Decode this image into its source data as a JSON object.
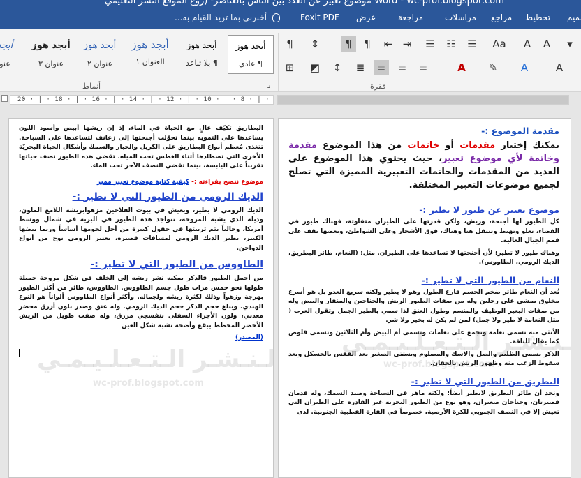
{
  "window": {
    "title": "Word - wc-prof.blogspot.com موضوع تعبير عن العدد بين الناس بالعناصر- (زوع الموقع النشر التعليمي"
  },
  "tabs": [
    {
      "label": "تصميم"
    },
    {
      "label": "تخطيط"
    },
    {
      "label": "مراجع"
    },
    {
      "label": "مراسلات"
    },
    {
      "label": "مراجعة"
    },
    {
      "label": "عرض"
    },
    {
      "label": "Foxit PDF"
    }
  ],
  "tell_me": {
    "text": "أخبرني بما تريد القيام به..."
  },
  "ribbon": {
    "group_styles_label": "أنماط",
    "group_paragraph_label": "فقرة",
    "styles": [
      {
        "preview": "أبجد هوز",
        "name": "¶ عادي"
      },
      {
        "preview": "أبجد هوز",
        "name": "¶ بلا تباعد"
      },
      {
        "preview": "أبجد هوز",
        "name": "العنوان ١"
      },
      {
        "preview": "أبجد هوز",
        "name": "عنوان ٢"
      },
      {
        "preview": "أبجد هوز",
        "name": "عنوان ٣"
      },
      {
        "preview": "أبجد هوز",
        "name": "عنوان"
      },
      {
        "preview": "أبجد",
        "name": "عنو"
      }
    ],
    "icons": {
      "pilcrow": "¶",
      "rtl": "¶",
      "sort": "↕",
      "borders": "⊞",
      "shading": "◩"
    }
  },
  "ruler": {
    "numbers": "20 · | · 18 · | · 16 · | · 14 · | · 12 · | · 10 · | · 8 · | · 6 · | · 4 · | · 2 · | ·"
  },
  "right_page": {
    "intro_heading": "مقدمة الموضوع :-",
    "intro_text_1": "يمكنك إختيار ",
    "intro_red_1": "مقدمات",
    "intro_text_2": " أو ",
    "intro_red_2": "خاتمات",
    "intro_text_3": " من هذا الموضوع ",
    "intro_blue_1": "مقدمة وخاتمة لأي موضوع تعبير",
    "intro_text_4": "، حيث يحتوي هذا الموضوع على العديد من المقدمات والخاتمات التعبيرية المميزة التي تصلح لجميع موضوعات التعبير المختلفة.",
    "section1_heading": "موضوع تعبير عن طيور لا تطير :-",
    "section1_p1": "كل الطيور لها أجنحة، وريش، ولكن قدرتها على الطيران متفاوتة، فهناك طيور في الفضاء، تعلو وتهبط وتتنقل هنا وهناك، فوق الأشجار وعلى الشواطئ، وبعضها يقف على قمم الجبال العالية.",
    "section1_p2": "وهناك طيور لا تطير؛ لأن أجنحتها لا تساعدها على الطيران. مثل: (النعام، طائر البطريق، الديك الرومي، الطاووس).",
    "section2_heading": "النعام من الطيور التي لا تطير :-",
    "section2_p1": "تُعد أن النعام طائر ضخم الجسم فارع الطول وهو لا يطير ولكنه سريع العدو بل هو أسرع مخلوق يمشي على رجلين وله من صفات الطيور الريش والجناحين والمنقار والبيض وله من صفات البعير الوظيف والمنسم وطول العنق لذا سمي بالطير الجمل وتقول العرب ( مثل النعامة لا طير ولا جمل) لمن لم يكن له بخير ولا شر.",
    "section2_p2": "الأنثى منه تسمى نعامة وتجمع على نعامات وتسمى أم البيض وأم الثلاثين وتسمى قلوص كما يقال للناقة.",
    "section2_p3": "الذكر يسمى الظليم والصل والاسك والمصلوم ويسمى الصغير بعد الفقس بالحسكل ويعد سقوط الزغب منه وظهور الريش بالحفان.",
    "section3_heading": "البطريق من الطيور التي لا تطير :-",
    "section3_p1": "ونجد أن طائر البطريق لايطير أيضاً؛ ولكنه ماهر في السباحة وصيد السمك، وله قدمان قصيرتان، وجناحان صغيران، وهو نوع من الطيور البحرية غير القادرة على الطيران التي تعيش إلا في النصف الجنوبي للكرة الأرضية، خصوصاً في القارة القطبية الجنوبية. لدى"
  },
  "left_page": {
    "p_top": "البطاريق تكيّف عالٍ مع الحياة في الماء، إذ إن ريشها أبيض وأسود اللون يساعدها على التمويه بينما تحوّلت أجنحتها إلى زعانف لتساعدها على السباحة. تتغذى مُعظم أنواع البطاريق على الكريل والحبار والسمك وأشكال الحياة البحريّة الأخرى التي تصطادها أثناء الغطس تحت المياه. تقضي هذه الطيور نصف حياتها تقريباً على اليابسة، بينما تقضي النصف الآخر تحت الماء.",
    "note_red": "موضوع ننصح بقراءته :-",
    "note_link": "كيفية كتابة موضوع تعبير مميز",
    "section4_heading": "الديك الرومي من الطيور التي لا تطير :-",
    "section4_p1": "الديك الرومي لا يطير، ويعيش في بيوت الفلاحين مزهوابريشة اللامع الملون، وذيله الذي يشبه المروحة، تتواجد هذه الطيور في البرية في شمال ووسط أمريكا، وحالياً يتم تربيتها في حقول كبيرة من أجل لحومها أساساً وربما بيضها الكبير، يطير الديك الرومي لمسافات قصيرة، يعتبر الرومي نوع من أنواع الدواجن.",
    "section5_heading": "الطاووس من الطيور التي لا تطير :-",
    "section5_p1": "من أجمل الطيور فالذكر يمكنه نشر ريشه إلى الخلف في شكل مروحة جميلة طولها نحو خمس مرات طول جسم الطاووس. الطاووس، طائر من أكثر الطيور بهرجة وزهواً وذلك لكثرة ريشه ولجماله. وأكثر أنواع الطاووس ألواناً هو النوع الهندي. ويبلغ حجم الذكر حجم الديك الرومي. وله عنق وصدر بلون أزرق مخضر معدني، ولون الأجزاء السفلى بنفسجي مزرق، وله صفت طويل من الريش الأخضر المخطط يبقع وأضحة تشبه شكل العين",
    "source_label": "(المصدر)"
  },
  "watermark": {
    "text": "مـوقـع الـنـشـر الـتـعـلـيـمـي",
    "url": "wc-prof.blogspot.com"
  }
}
